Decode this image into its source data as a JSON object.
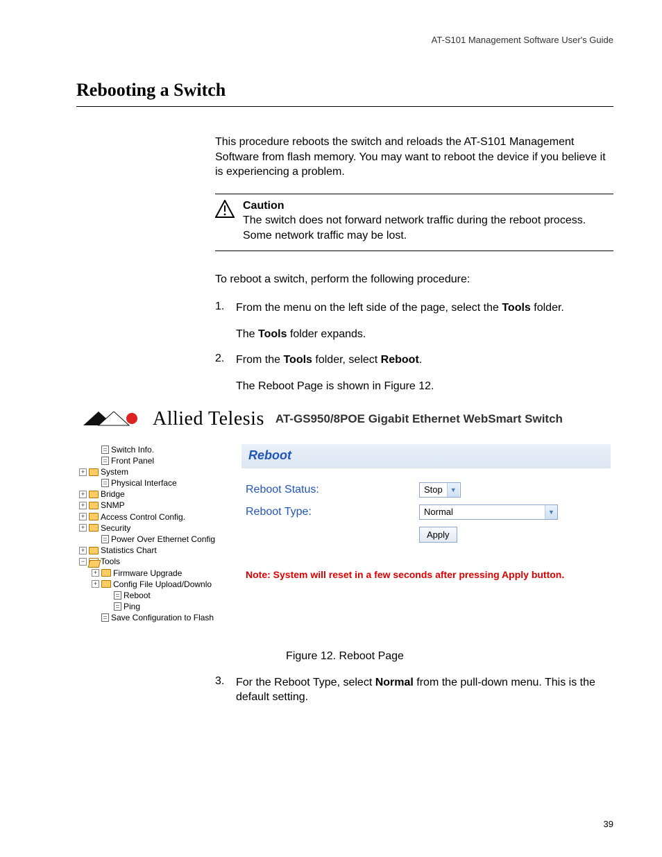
{
  "header": {
    "doc_title": "AT-S101 Management Software User's Guide"
  },
  "title": "Rebooting a Switch",
  "intro": "This procedure reboots the switch and reloads the AT-S101 Management Software from flash memory. You may want to reboot the device if you believe it is experiencing a problem.",
  "caution": {
    "heading": "Caution",
    "text": "The switch does not forward network traffic during the reboot process. Some network traffic may be lost."
  },
  "lead_in": "To reboot a switch, perform the following procedure:",
  "steps": {
    "s1_num": "1.",
    "s1_a": "From the menu on the left side of the page, select the ",
    "s1_b": "Tools",
    "s1_c": " folder.",
    "s1_sub_a": "The ",
    "s1_sub_b": "Tools",
    "s1_sub_c": " folder expands.",
    "s2_num": "2.",
    "s2_a": "From the ",
    "s2_b": "Tools",
    "s2_c": " folder, select ",
    "s2_d": "Reboot",
    "s2_e": ".",
    "s2_sub": "The Reboot Page is shown in Figure 12.",
    "s3_num": "3.",
    "s3_a": "For the Reboot Type, select ",
    "s3_b": "Normal",
    "s3_c": " from the pull-down menu. This is the default setting."
  },
  "screenshot": {
    "brand": "Allied Telesis",
    "product": "AT-GS950/8POE Gigabit Ethernet WebSmart Switch",
    "tree": {
      "switch_info": "Switch Info.",
      "front_panel": "Front Panel",
      "system": "System",
      "physical_interface": "Physical Interface",
      "bridge": "Bridge",
      "snmp": "SNMP",
      "acl": "Access Control Config.",
      "security": "Security",
      "poe": "Power Over Ethernet Config",
      "stats": "Statistics Chart",
      "tools": "Tools",
      "firmware": "Firmware Upgrade",
      "config_file": "Config File Upload/Downlo",
      "reboot": "Reboot",
      "ping": "Ping",
      "save_flash": "Save Configuration to Flash"
    },
    "panel": {
      "title": "Reboot",
      "status_label": "Reboot Status:",
      "status_value": "Stop",
      "type_label": "Reboot Type:",
      "type_value": "Normal",
      "apply": "Apply",
      "note": "Note: System will reset in a few seconds after pressing Apply button."
    }
  },
  "figure_caption": "Figure 12. Reboot Page",
  "page_number": "39"
}
